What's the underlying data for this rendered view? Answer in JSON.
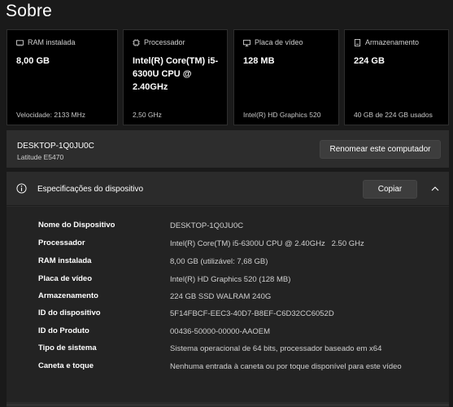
{
  "page_title": "Sobre",
  "cards": [
    {
      "label": "RAM instalada",
      "value": "8,00 GB",
      "footer": "Velocidade: 2133 MHz",
      "icon": "ram-icon"
    },
    {
      "label": "Processador",
      "value": "Intel(R) Core(TM) i5-6300U CPU @ 2.40GHz",
      "footer": "2,50 GHz",
      "icon": "processor-icon"
    },
    {
      "label": "Placa de vídeo",
      "value": "128 MB",
      "footer": "Intel(R) HD Graphics 520",
      "icon": "gpu-icon"
    },
    {
      "label": "Armazenamento",
      "value": "224 GB",
      "footer": "40 GB de 224 GB usados",
      "icon": "storage-icon"
    }
  ],
  "device": {
    "name": "DESKTOP-1Q0JU0C",
    "model": "Latitude E5470",
    "rename_label": "Renomear este computador"
  },
  "specs": {
    "title": "Especificações do dispositivo",
    "copy_label": "Copiar",
    "rows": [
      {
        "label": "Nome do Dispositivo",
        "value": "DESKTOP-1Q0JU0C"
      },
      {
        "label": "Processador",
        "value": "Intel(R) Core(TM) i5-6300U CPU @ 2.40GHz   2.50 GHz"
      },
      {
        "label": "RAM instalada",
        "value": "8,00 GB (utilizável: 7,68 GB)"
      },
      {
        "label": "Placa de vídeo",
        "value": "Intel(R) HD Graphics 520 (128 MB)"
      },
      {
        "label": "Armazenamento",
        "value": "224 GB SSD WALRAM 240G"
      },
      {
        "label": "ID do dispositivo",
        "value": "5F14FBCF-EEC3-40D7-B8EF-C6D32CC6052D"
      },
      {
        "label": "ID do Produto",
        "value": "00436-50000-00000-AAOEM"
      },
      {
        "label": "Tipo de sistema",
        "value": "Sistema operacional de 64 bits, processador baseado em x64"
      },
      {
        "label": "Caneta e toque",
        "value": "Nenhuma entrada à caneta ou por toque disponível para este vídeo"
      }
    ]
  },
  "colors": {
    "background": "#1a1a1a",
    "card_background": "#000000",
    "panel_background": "#2b2b2b",
    "button_background": "#3d3d3d"
  }
}
